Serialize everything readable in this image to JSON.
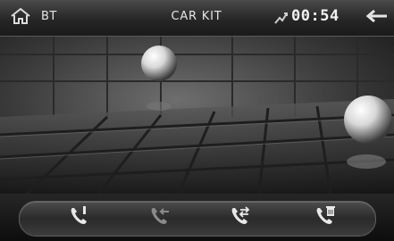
{
  "header": {
    "source_label": "BT",
    "title": "CAR KIT",
    "clock": "00:54"
  },
  "icons": {
    "home": "home-icon",
    "signal": "signal-icon",
    "back": "back-arrow-icon",
    "call": "phone-call-icon",
    "transfer": "phone-transfer-icon",
    "redial": "phone-redial-icon",
    "delete": "phone-delete-icon"
  },
  "colors": {
    "header_bg": "#2a2a2a",
    "text": "#e6e6e6",
    "icon_active": "#e8e8e8",
    "icon_dim": "#8a8a8a"
  }
}
